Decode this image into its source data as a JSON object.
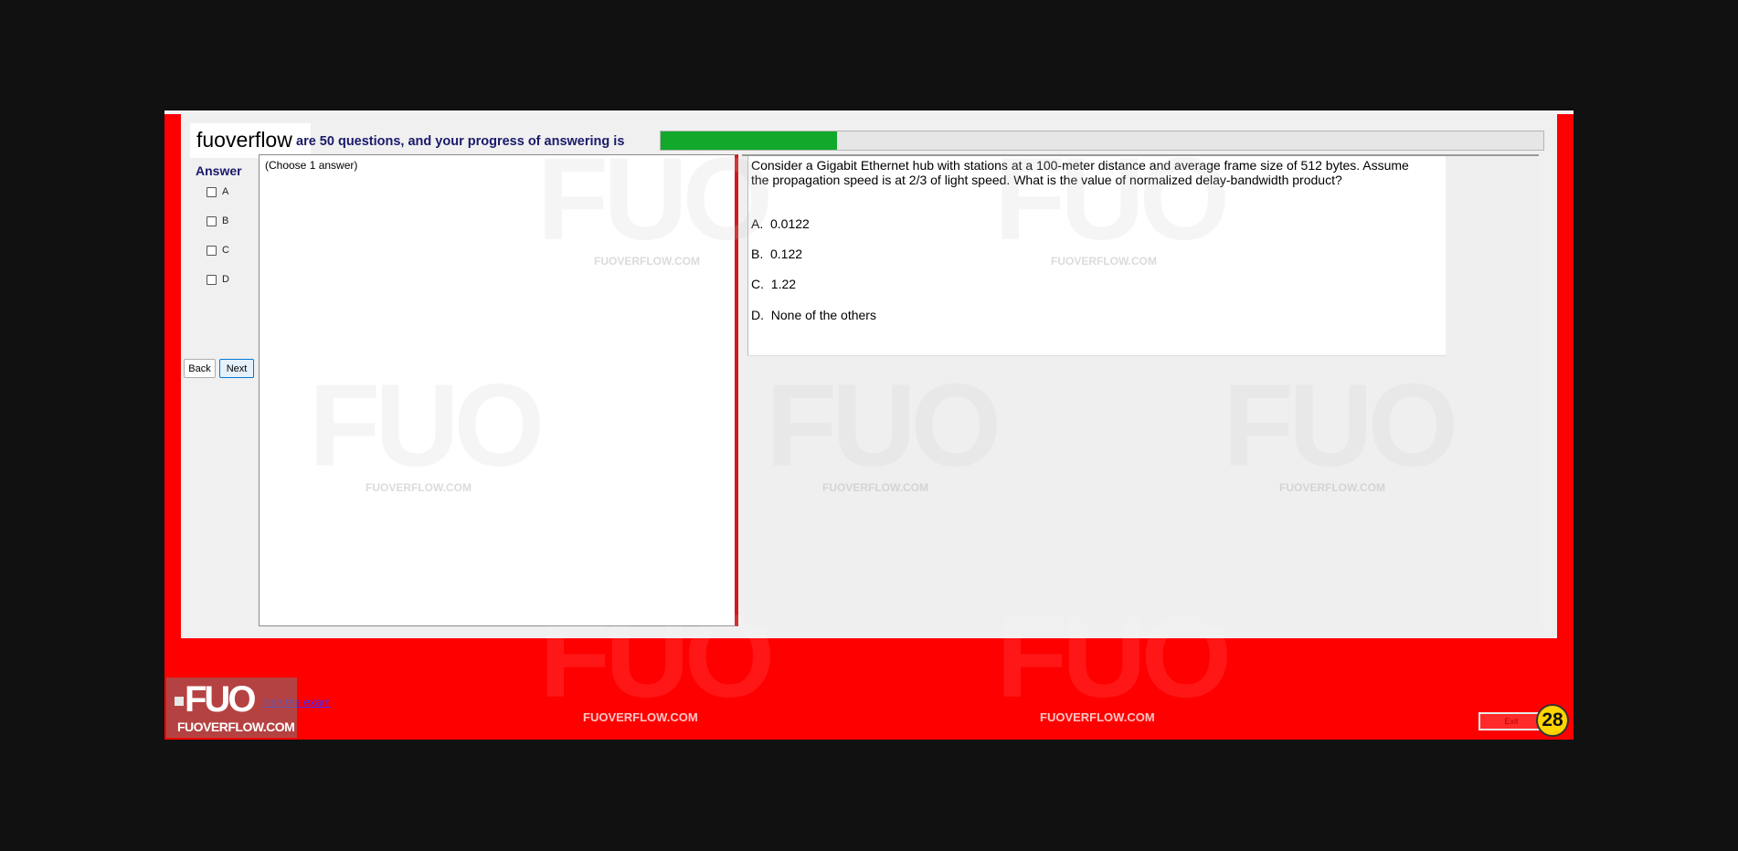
{
  "header": {
    "brand": "fuoverflow",
    "progress_label": "are 50 questions, and your progress of answering is",
    "progress_fraction": 0.2
  },
  "answer_panel": {
    "title": "Answer",
    "options": [
      "A",
      "B",
      "C",
      "D"
    ],
    "back_label": "Back",
    "next_label": "Next",
    "hint": "(Choose 1 answer)"
  },
  "question": {
    "text": "Consider a Gigabit Ethernet hub with stations at a 100-meter distance and average frame size of 512 bytes. Assume the propagation speed is at 2/3 of light speed. What is the value of normalized delay-bandwidth product?",
    "choices": [
      "A.  0.0122",
      "B.  0.122",
      "C.  1.22",
      "D.  None of the others"
    ]
  },
  "footer": {
    "finish_label": "nish the exam",
    "watermark_url": "FUOVERFLOW.COM",
    "logo_text": "FUO",
    "logo_url": "FUOVERFLOW.COM",
    "exit_label": "Exit",
    "timer_value": "28"
  },
  "watermark": {
    "text": "FUO",
    "url": "FUOVERFLOW.COM"
  },
  "colors": {
    "frame": "#ff0000",
    "progress": "#12a82c",
    "heading": "#1a1a6b",
    "timer": "#ffd400"
  }
}
